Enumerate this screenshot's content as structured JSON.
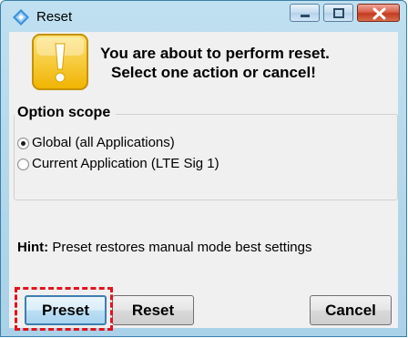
{
  "window": {
    "title": "Reset",
    "app_icon": "diamond-app-icon"
  },
  "title_controls": {
    "minimize_icon": "minimize-icon",
    "maximize_icon": "maximize-icon",
    "close_icon": "close-icon"
  },
  "message": {
    "icon": "warning-exclamation-icon",
    "line1": "You are about to perform reset.",
    "line2": "Select one action or cancel!"
  },
  "option_scope": {
    "legend": "Option scope",
    "options": [
      {
        "label": "Global (all Applications)",
        "selected": true
      },
      {
        "label": "Current Application (LTE Sig 1)",
        "selected": false
      }
    ]
  },
  "hint": {
    "label": "Hint:",
    "text": "Preset restores manual mode best settings"
  },
  "buttons": {
    "preset": "Preset",
    "reset": "Reset",
    "cancel": "Cancel"
  },
  "colors": {
    "highlight": "#e0141e",
    "window_frame": "#a9d1e8",
    "dialog_background": "#f0f0f0",
    "warning_icon": "#f6c520"
  }
}
